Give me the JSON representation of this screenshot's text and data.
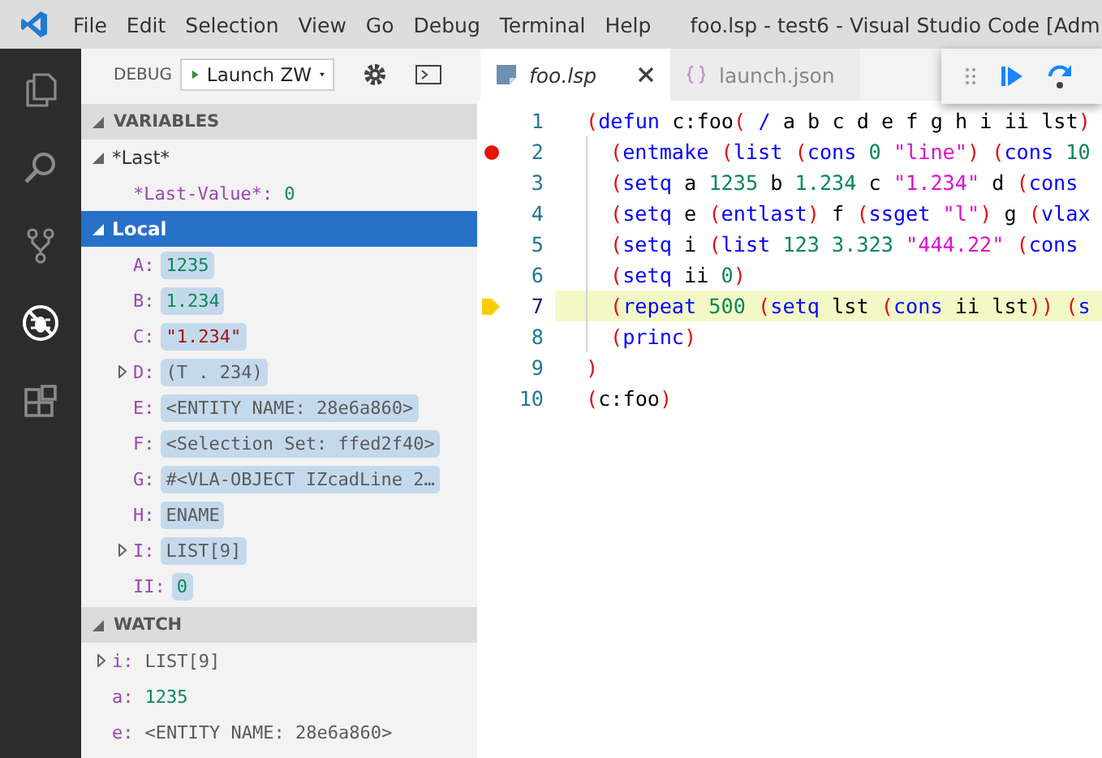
{
  "window": {
    "title": "foo.lsp - test6 - Visual Studio Code [Adm"
  },
  "menu": [
    "File",
    "Edit",
    "Selection",
    "View",
    "Go",
    "Debug",
    "Terminal",
    "Help"
  ],
  "activity_bar": [
    {
      "kind": "files",
      "selected": false
    },
    {
      "kind": "search",
      "selected": false
    },
    {
      "kind": "source-control",
      "selected": false
    },
    {
      "kind": "debug",
      "selected": true
    },
    {
      "kind": "extensions",
      "selected": false
    }
  ],
  "debug_toolbar": {
    "label": "DEBUG",
    "config": "Launch ZW"
  },
  "variables": {
    "title": "VARIABLES",
    "expanded": true,
    "scopes": [
      {
        "name": "*Last*",
        "expanded": true,
        "selected": false,
        "children": [
          {
            "name": "*Last-Value*:",
            "value": "0",
            "kind": "num",
            "changed": false,
            "expandable": false
          }
        ]
      },
      {
        "name": "Local",
        "expanded": true,
        "selected": true,
        "children": [
          {
            "name": "A:",
            "value": "1235",
            "kind": "num",
            "changed": true,
            "expandable": false
          },
          {
            "name": "B:",
            "value": "1.234",
            "kind": "num",
            "changed": true,
            "expandable": false
          },
          {
            "name": "C:",
            "value": "\"1.234\"",
            "kind": "str",
            "changed": true,
            "expandable": false
          },
          {
            "name": "D:",
            "value": "(T . 234)",
            "kind": "other",
            "changed": true,
            "expandable": true
          },
          {
            "name": "E:",
            "value": "<ENTITY NAME: 28e6a860>",
            "kind": "other",
            "changed": true,
            "expandable": false
          },
          {
            "name": "F:",
            "value": "<Selection Set: ffed2f40>",
            "kind": "other",
            "changed": true,
            "expandable": false
          },
          {
            "name": "G:",
            "value": "#<VLA-OBJECT  IZcadLine 2…",
            "kind": "other",
            "changed": true,
            "expandable": false
          },
          {
            "name": "H:",
            "value": "ENAME",
            "kind": "other",
            "changed": true,
            "expandable": false
          },
          {
            "name": "I:",
            "value": "LIST[9]",
            "kind": "other",
            "changed": true,
            "expandable": true
          },
          {
            "name": "II:",
            "value": "0",
            "kind": "num",
            "changed": true,
            "expandable": false
          }
        ]
      }
    ]
  },
  "watch": {
    "title": "WATCH",
    "expanded": true,
    "items": [
      {
        "name": "i:",
        "value": "LIST[9]",
        "kind": "other",
        "changed": false,
        "expandable": true
      },
      {
        "name": "a:",
        "value": "1235",
        "kind": "num",
        "changed": false,
        "expandable": false
      },
      {
        "name": "e:",
        "value": "<ENTITY NAME: 28e6a860>",
        "kind": "other",
        "changed": false,
        "expandable": false
      }
    ]
  },
  "tabs": [
    {
      "label": "foo.lsp",
      "kind": "lisp",
      "selected": true
    },
    {
      "label": "launch.json",
      "kind": "json",
      "selected": false
    }
  ],
  "editor": {
    "lines": [
      {
        "number": "1",
        "indented": false,
        "breakpoint": false,
        "current": false,
        "tokens": [
          {
            "kind": "paren",
            "text": "("
          },
          {
            "kind": "keyword",
            "text": "defun"
          },
          {
            "kind": "ident",
            "text": " c:foo"
          },
          {
            "kind": "paren",
            "text": "("
          },
          {
            "kind": "keyword",
            "text": " /"
          },
          {
            "kind": "ident",
            "text": " a b c d e f g h i ii lst"
          },
          {
            "kind": "paren",
            "text": ")"
          }
        ]
      },
      {
        "number": "2",
        "indented": true,
        "breakpoint": true,
        "current": false,
        "tokens": [
          {
            "kind": "paren",
            "text": "("
          },
          {
            "kind": "keyword",
            "text": "entmake"
          },
          {
            "kind": "paren",
            "text": " ("
          },
          {
            "kind": "keyword",
            "text": "list"
          },
          {
            "kind": "paren",
            "text": " ("
          },
          {
            "kind": "keyword",
            "text": "cons"
          },
          {
            "kind": "number",
            "text": " 0"
          },
          {
            "kind": "string",
            "text": " \"line\""
          },
          {
            "kind": "paren",
            "text": ")"
          },
          {
            "kind": "paren",
            "text": " ("
          },
          {
            "kind": "keyword",
            "text": "cons"
          },
          {
            "kind": "number",
            "text": " 10"
          }
        ]
      },
      {
        "number": "3",
        "indented": true,
        "breakpoint": false,
        "current": false,
        "tokens": [
          {
            "kind": "paren",
            "text": "("
          },
          {
            "kind": "keyword",
            "text": "setq"
          },
          {
            "kind": "ident",
            "text": " a"
          },
          {
            "kind": "number",
            "text": " 1235"
          },
          {
            "kind": "ident",
            "text": " b"
          },
          {
            "kind": "number",
            "text": " 1.234"
          },
          {
            "kind": "ident",
            "text": " c"
          },
          {
            "kind": "string",
            "text": " \"1.234\""
          },
          {
            "kind": "ident",
            "text": " d"
          },
          {
            "kind": "paren",
            "text": " ("
          },
          {
            "kind": "keyword",
            "text": "cons"
          }
        ]
      },
      {
        "number": "4",
        "indented": true,
        "breakpoint": false,
        "current": false,
        "tokens": [
          {
            "kind": "paren",
            "text": "("
          },
          {
            "kind": "keyword",
            "text": "setq"
          },
          {
            "kind": "ident",
            "text": " e"
          },
          {
            "kind": "paren",
            "text": " ("
          },
          {
            "kind": "keyword",
            "text": "entlast"
          },
          {
            "kind": "paren",
            "text": ")"
          },
          {
            "kind": "ident",
            "text": " f"
          },
          {
            "kind": "paren",
            "text": " ("
          },
          {
            "kind": "keyword",
            "text": "ssget"
          },
          {
            "kind": "string",
            "text": " \"l\""
          },
          {
            "kind": "paren",
            "text": ")"
          },
          {
            "kind": "ident",
            "text": " g"
          },
          {
            "kind": "paren",
            "text": " ("
          },
          {
            "kind": "keyword",
            "text": "vlax"
          }
        ]
      },
      {
        "number": "5",
        "indented": true,
        "breakpoint": false,
        "current": false,
        "tokens": [
          {
            "kind": "paren",
            "text": "("
          },
          {
            "kind": "keyword",
            "text": "setq"
          },
          {
            "kind": "ident",
            "text": " i"
          },
          {
            "kind": "paren",
            "text": " ("
          },
          {
            "kind": "keyword",
            "text": "list"
          },
          {
            "kind": "number",
            "text": " 123 3.323"
          },
          {
            "kind": "string",
            "text": " \"444.22\""
          },
          {
            "kind": "paren",
            "text": " ("
          },
          {
            "kind": "keyword",
            "text": "cons"
          }
        ]
      },
      {
        "number": "6",
        "indented": true,
        "breakpoint": false,
        "current": false,
        "tokens": [
          {
            "kind": "paren",
            "text": "("
          },
          {
            "kind": "keyword",
            "text": "setq"
          },
          {
            "kind": "ident",
            "text": " ii"
          },
          {
            "kind": "number",
            "text": " 0"
          },
          {
            "kind": "paren",
            "text": ")"
          }
        ]
      },
      {
        "number": "7",
        "indented": true,
        "breakpoint": false,
        "current": true,
        "tokens": [
          {
            "kind": "paren",
            "text": "("
          },
          {
            "kind": "keyword",
            "text": "repeat"
          },
          {
            "kind": "number",
            "text": " 500"
          },
          {
            "kind": "paren",
            "text": " ("
          },
          {
            "kind": "keyword",
            "text": "setq"
          },
          {
            "kind": "ident",
            "text": " lst"
          },
          {
            "kind": "paren",
            "text": " ("
          },
          {
            "kind": "keyword",
            "text": "cons"
          },
          {
            "kind": "ident",
            "text": " ii lst"
          },
          {
            "kind": "paren",
            "text": "))"
          },
          {
            "kind": "paren",
            "text": " ("
          },
          {
            "kind": "keyword",
            "text": "s"
          }
        ]
      },
      {
        "number": "8",
        "indented": true,
        "breakpoint": false,
        "current": false,
        "tokens": [
          {
            "kind": "paren",
            "text": "("
          },
          {
            "kind": "keyword",
            "text": "princ"
          },
          {
            "kind": "paren",
            "text": ")"
          }
        ]
      },
      {
        "number": "9",
        "indented": false,
        "breakpoint": false,
        "current": false,
        "tokens": [
          {
            "kind": "paren",
            "text": ")"
          }
        ]
      },
      {
        "number": "10",
        "indented": false,
        "breakpoint": false,
        "current": false,
        "tokens": [
          {
            "kind": "paren",
            "text": "("
          },
          {
            "kind": "ident",
            "text": "c:foo"
          },
          {
            "kind": "paren",
            "text": ")"
          }
        ]
      }
    ]
  }
}
